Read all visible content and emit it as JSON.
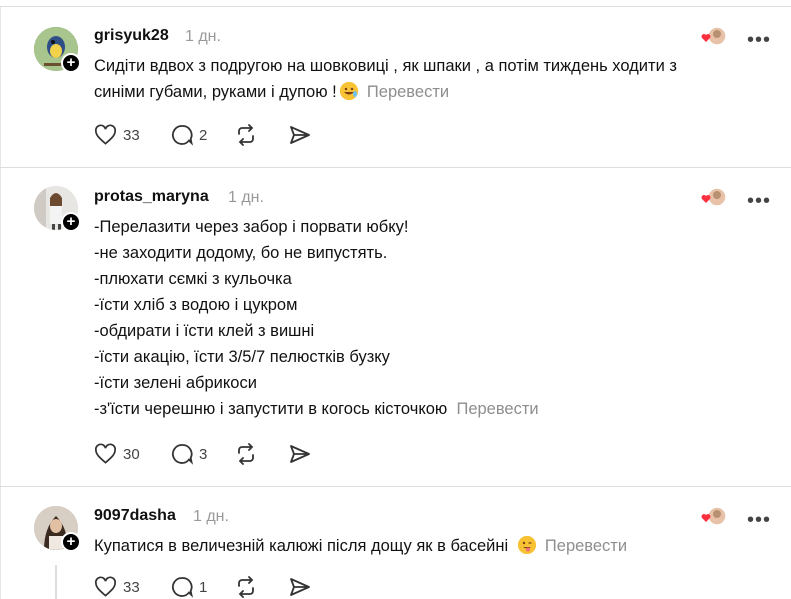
{
  "posts": [
    {
      "username": "grisyuk28",
      "time": "1 дн.",
      "lines": [
        "Сидіти вдвох з подругою на шовковиці , як шпаки , а потім тиждень ходити з",
        "синіми губами, руками і дупою !"
      ],
      "emoji": "rofl-emoji",
      "translate": "Перевести",
      "likes": "33",
      "replies": "2"
    },
    {
      "username": "protas_maryna",
      "time": "1 дн.",
      "lines": [
        "-Перелазити через забор і порвати юбку!",
        "-не заходити додому, бо не випустять.",
        "-плюхати сємкі з кульочка",
        "-їсти хліб з водою і цукром",
        "-обдирати і їсти клей з вишні",
        "-їсти акацію, їсти 3/5/7 пелюстків бузку",
        "-їсти зелені абрикоси",
        "-з'їсти черешню і запустити в когось кісточкою"
      ],
      "translate": "Перевести",
      "likes": "30",
      "replies": "3"
    },
    {
      "username": "9097dasha",
      "time": "1 дн.",
      "lines": [
        "Купатися в величезній калюжі після дощу як в басейні"
      ],
      "emoji": "winking-tongue-emoji",
      "translate": "Перевести",
      "likes": "33",
      "replies": "1"
    }
  ],
  "icons": {
    "like": "heart-icon",
    "reply": "comment-icon",
    "repost": "repost-icon",
    "share": "send-icon",
    "more": "more-icon",
    "reaction": "liked-avatar-icon"
  },
  "more_label": "•••"
}
